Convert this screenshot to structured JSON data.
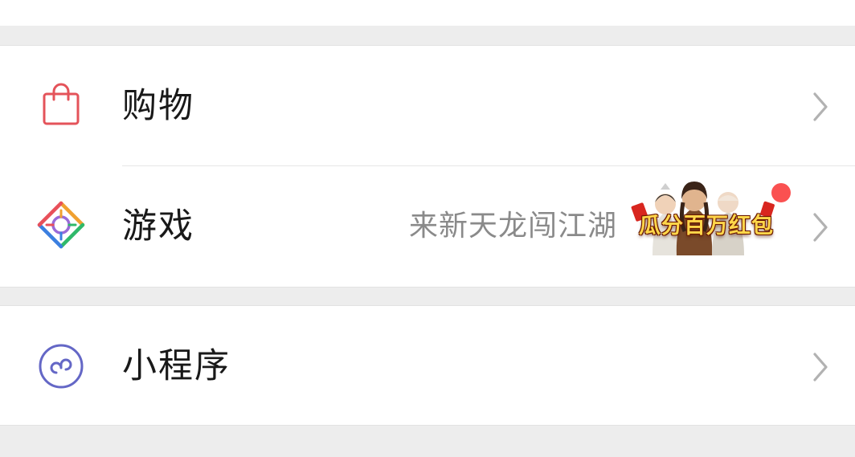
{
  "menu": {
    "shopping": {
      "label": "购物",
      "icon": "shopping-bag-icon",
      "icon_color": "#e4535a"
    },
    "games": {
      "label": "游戏",
      "icon": "games-diamond-icon",
      "promo_text": "来新天龙闯江湖",
      "banner_text": "瓜分百万红包",
      "badge_color": "#fa5151"
    },
    "mini_programs": {
      "label": "小程序",
      "icon": "mini-program-icon",
      "icon_color": "#6467c6"
    }
  },
  "colors": {
    "background": "#ededed",
    "card": "#ffffff",
    "text_primary": "#191919",
    "text_secondary": "#8a8a8a",
    "chevron": "#b2b2b2"
  }
}
